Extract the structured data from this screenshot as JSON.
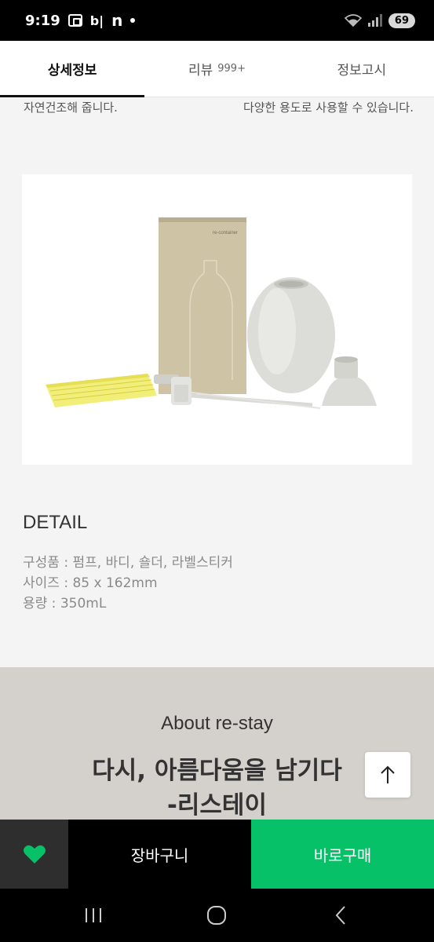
{
  "status_bar": {
    "time": "9:19",
    "icons": [
      "screenshot-icon",
      "b-icon",
      "n-icon",
      "dot-icon"
    ],
    "battery": "69"
  },
  "tabs": [
    {
      "label": "상세정보",
      "active": true
    },
    {
      "label": "리뷰",
      "count": "999+",
      "active": false
    },
    {
      "label": "정보고시",
      "active": false
    }
  ],
  "content": {
    "cut_left": "자연건조해 줍니다.",
    "cut_right": "다양한 용도로 사용할 수 있습니다.",
    "detail": {
      "heading": "DETAIL",
      "lines": [
        "구성품 : 펌프, 바디, 숄더, 라벨스티커",
        "사이즈 : 85 x 162mm",
        "용량 : 350mL"
      ]
    },
    "about": {
      "title": "About re-stay",
      "main_line1": "다시, 아름다움을 남기다",
      "main_line2": "-리스테이"
    }
  },
  "product_image": {
    "box_label": "re-container"
  },
  "actions": {
    "cart_label": "장바구니",
    "buy_label": "바로구매"
  },
  "colors": {
    "buy_green": "#06c168",
    "about_bg": "#d4d0cb",
    "wish_heart": "#06c168"
  }
}
